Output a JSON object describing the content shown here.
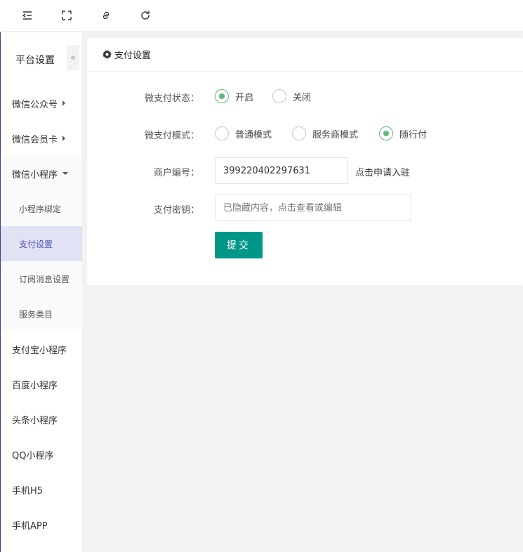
{
  "topbar": {
    "icons": [
      "menu-fold-icon",
      "fullscreen-icon",
      "link-icon",
      "refresh-icon"
    ]
  },
  "sidebar": {
    "title": "平台设置",
    "collapse_glyph": "«",
    "items": [
      {
        "label": "微信公众号",
        "expanded": false
      },
      {
        "label": "微信会员卡",
        "expanded": false
      },
      {
        "label": "微信小程序",
        "expanded": true
      },
      {
        "label": "小程序绑定",
        "sub": true
      },
      {
        "label": "支付设置",
        "sub": true,
        "active": true
      },
      {
        "label": "订阅消息设置",
        "sub": true
      },
      {
        "label": "服务类目",
        "sub": true
      },
      {
        "label": "支付宝小程序"
      },
      {
        "label": "百度小程序"
      },
      {
        "label": "头条小程序"
      },
      {
        "label": "QQ小程序"
      },
      {
        "label": "手机H5"
      },
      {
        "label": "手机APP"
      }
    ]
  },
  "panel": {
    "title": "支付设置",
    "status": {
      "label": "微支付状态：",
      "options": [
        {
          "label": "开启",
          "checked": true
        },
        {
          "label": "关闭",
          "checked": false
        }
      ]
    },
    "mode": {
      "label": "微支付模式：",
      "options": [
        {
          "label": "普通模式",
          "checked": false
        },
        {
          "label": "服务商模式",
          "checked": false
        },
        {
          "label": "随行付",
          "checked": true
        }
      ]
    },
    "merchant": {
      "label": "商户编号：",
      "value": "399220402297631",
      "hint": "点击申请入驻"
    },
    "secret": {
      "label": "支付密钥：",
      "placeholder": "已隐藏内容，点击查看或编辑"
    },
    "submit_label": "提交"
  },
  "colors": {
    "accent": "#009688",
    "radio_checked": "#5fb878",
    "active_menu_bg": "#e2e2f5",
    "active_menu_text": "#4d53b3"
  }
}
